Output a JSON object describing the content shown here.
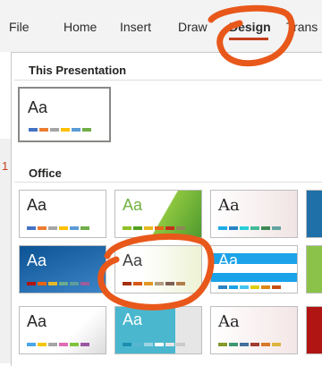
{
  "ribbon": {
    "tabs": [
      {
        "label": "File"
      },
      {
        "label": "Home"
      },
      {
        "label": "Insert"
      },
      {
        "label": "Draw"
      },
      {
        "label": "Design"
      },
      {
        "label": "Trans"
      }
    ],
    "active_tab": "Design"
  },
  "slide_number": "1",
  "gallery": {
    "this_presentation_title": "This Presentation",
    "office_title": "Office",
    "thumb_label": "Aa"
  },
  "colors": {
    "accent": "#c43e1c",
    "annotation": "#e8581b"
  }
}
